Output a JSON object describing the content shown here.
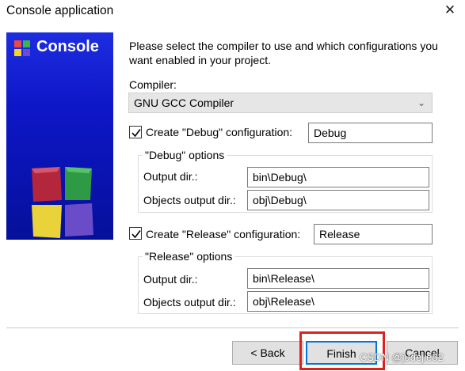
{
  "window": {
    "title": "Console application",
    "close_glyph": "✕"
  },
  "banner": {
    "title": "Console",
    "logo_icon": "codeblocks-logo-icon"
  },
  "intro": "Please select the compiler to use and which configurations you want enabled in your project.",
  "compiler": {
    "label": "Compiler:",
    "value": "GNU GCC Compiler"
  },
  "debug": {
    "checked": true,
    "label": "Create \"Debug\" configuration:",
    "name": "Debug",
    "group_label": "\"Debug\" options",
    "output_label": "Output dir.:",
    "output_value": "bin\\Debug\\",
    "objects_label": "Objects output dir.:",
    "objects_value": "obj\\Debug\\"
  },
  "release": {
    "checked": true,
    "label": "Create \"Release\" configuration:",
    "name": "Release",
    "group_label": "\"Release\" options",
    "output_label": "Output dir.:",
    "output_value": "bin\\Release\\",
    "objects_label": "Objects output dir.:",
    "objects_value": "obj\\Release\\"
  },
  "buttons": {
    "back": "< Back",
    "finish": "Finish",
    "cancel": "Cancel"
  },
  "watermark": "CSDN @judejie82",
  "colors": {
    "banner": "#0e17c8",
    "highlight": "#e0201f",
    "focus": "#0078d7"
  }
}
